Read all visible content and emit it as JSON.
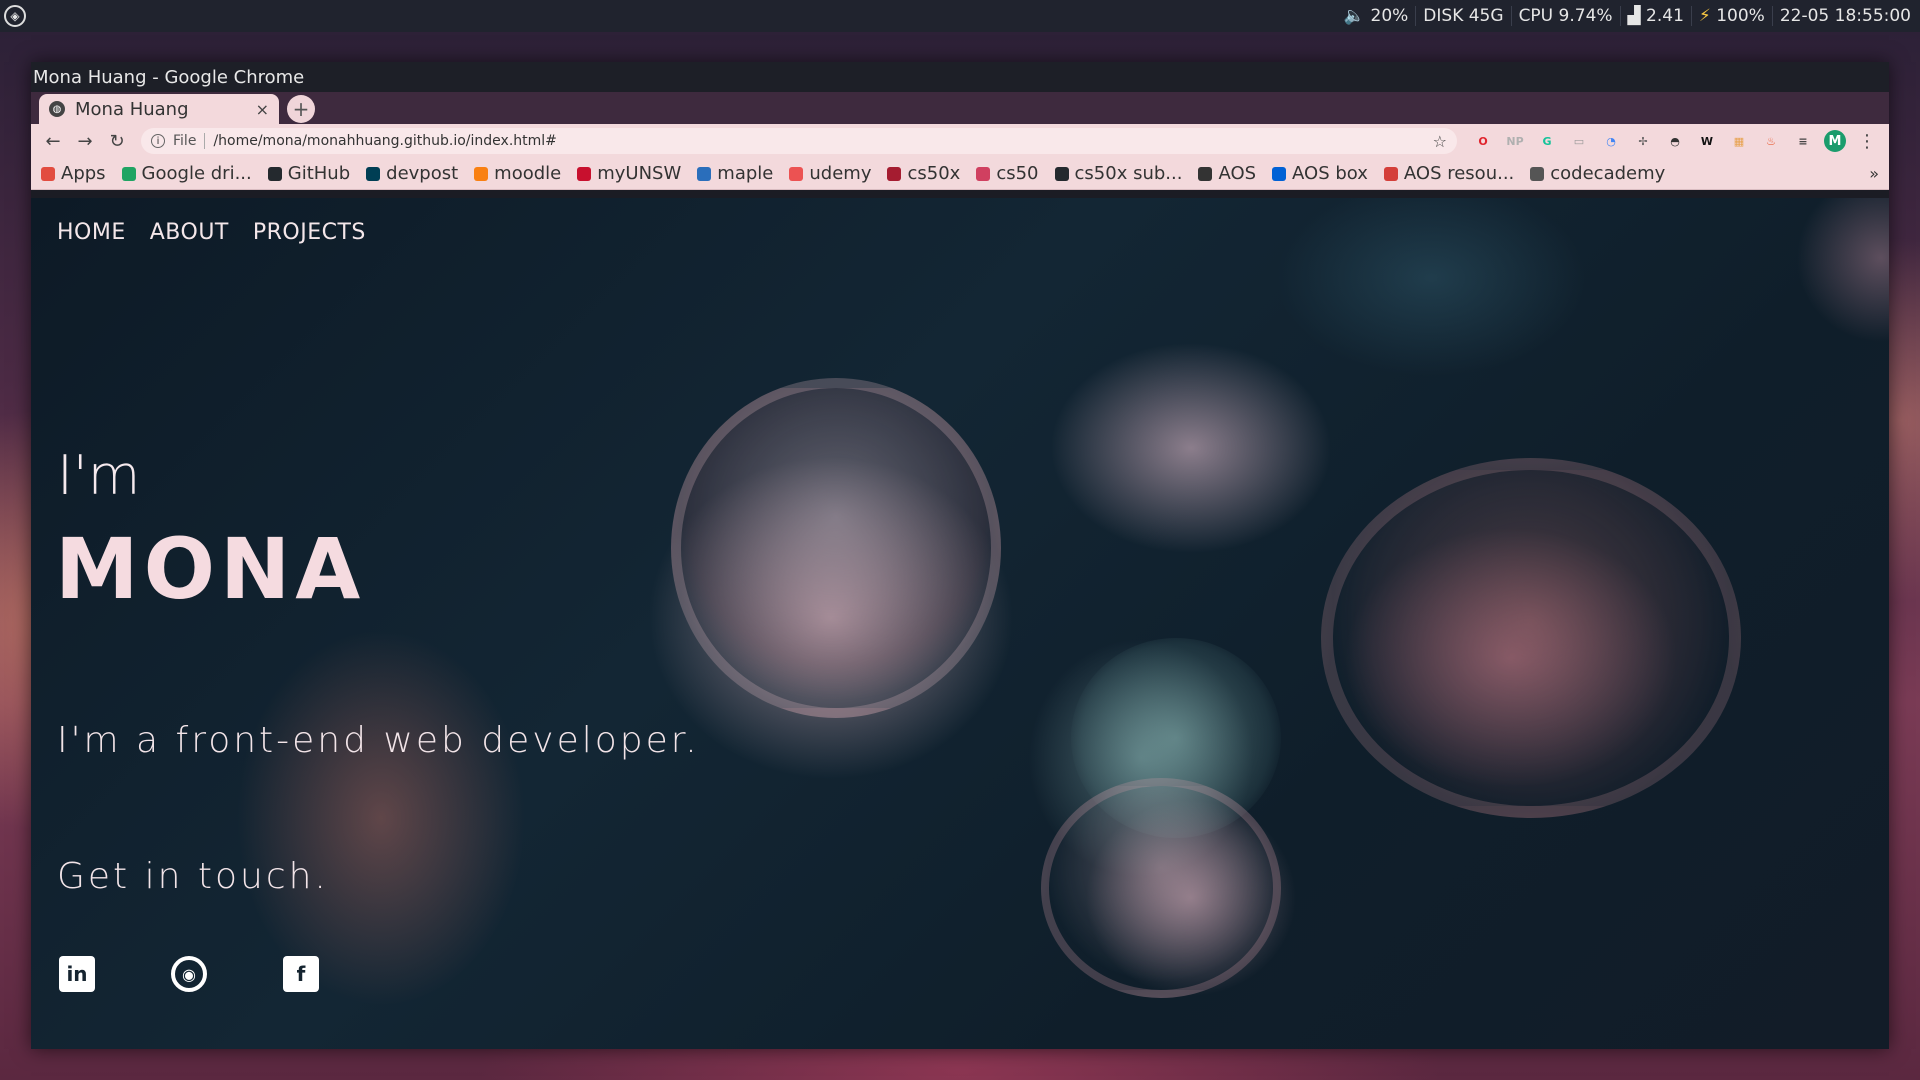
{
  "system_bar": {
    "volume": "20%",
    "disk": "DISK 45G",
    "cpu": "CPU 9.74%",
    "load": "2.41",
    "battery": "100%",
    "datetime": "22-05 18:55:00"
  },
  "window": {
    "title": "Mona Huang - Google Chrome"
  },
  "tabs": [
    {
      "title": "Mona Huang",
      "close": "×"
    }
  ],
  "new_tab_label": "+",
  "toolbar": {
    "back": "←",
    "forward": "→",
    "reload": "↻",
    "scheme": "File",
    "url": "/home/mona/monahhuang.github.io/index.html#",
    "star": "☆",
    "menu": "⋮",
    "profile_initial": "M"
  },
  "extensions": [
    {
      "name": "opera-icon",
      "glyph": "O",
      "color": "#e0242d"
    },
    {
      "name": "np-icon",
      "glyph": "NP",
      "color": "#b0b0b0"
    },
    {
      "name": "grammarly-icon",
      "glyph": "G",
      "color": "#15c39a"
    },
    {
      "name": "extension-card-icon",
      "glyph": "▭",
      "color": "#999999"
    },
    {
      "name": "chrome-color-icon",
      "glyph": "◔",
      "color": "#4285f4"
    },
    {
      "name": "sparkle-icon",
      "glyph": "✢",
      "color": "#555555"
    },
    {
      "name": "spy-icon",
      "glyph": "◓",
      "color": "#333333"
    },
    {
      "name": "wm-icon",
      "glyph": "W",
      "color": "#111111"
    },
    {
      "name": "puzzle-color-icon",
      "glyph": "▦",
      "color": "#e7a04a"
    },
    {
      "name": "fire-icon",
      "glyph": "♨",
      "color": "#e8542a"
    },
    {
      "name": "playlist-icon",
      "glyph": "≡",
      "color": "#444444"
    }
  ],
  "bookmarks": [
    {
      "label": "Apps",
      "color": "#e24c3f"
    },
    {
      "label": "Google dri...",
      "color": "#1fa463"
    },
    {
      "label": "GitHub",
      "color": "#24292e"
    },
    {
      "label": "devpost",
      "color": "#003e54"
    },
    {
      "label": "moodle",
      "color": "#f98012"
    },
    {
      "label": "myUNSW",
      "color": "#c8102e"
    },
    {
      "label": "maple",
      "color": "#2a6ebb"
    },
    {
      "label": "udemy",
      "color": "#ec5252"
    },
    {
      "label": "cs50x",
      "color": "#a51c30"
    },
    {
      "label": "cs50",
      "color": "#d04060"
    },
    {
      "label": "cs50x sub...",
      "color": "#24292e"
    },
    {
      "label": "AOS",
      "color": "#333333"
    },
    {
      "label": "AOS box",
      "color": "#0061d5"
    },
    {
      "label": "AOS resou...",
      "color": "#d43f3a"
    },
    {
      "label": "codecademy",
      "color": "#555555"
    }
  ],
  "bookmarks_more": "»",
  "page": {
    "nav": [
      "HOME",
      "ABOUT",
      "PROJECTS"
    ],
    "intro": "I'm",
    "name": "MONA",
    "subtitle": "I'm a front-end web developer.",
    "contact": "Get in touch.",
    "socials": [
      {
        "name": "linkedin",
        "glyph": "in"
      },
      {
        "name": "github",
        "glyph": "◉"
      },
      {
        "name": "facebook",
        "glyph": "f"
      }
    ]
  }
}
